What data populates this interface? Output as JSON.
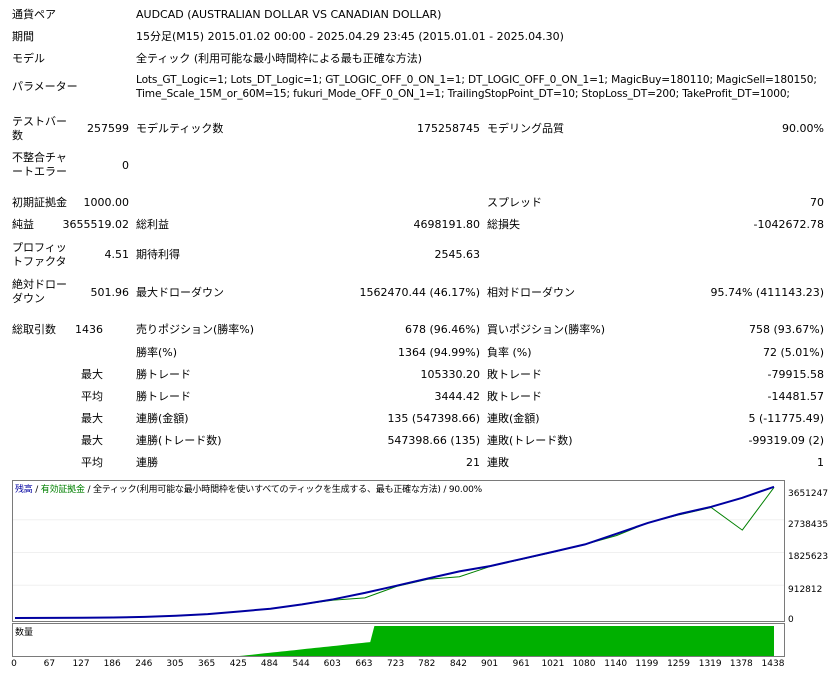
{
  "header": {
    "symbol_label": "通貨ペア",
    "symbol_value": "AUDCAD (AUSTRALIAN DOLLAR VS CANADIAN DOLLAR)",
    "period_label": "期間",
    "period_value": "15分足(M15) 2015.01.02 00:00 - 2025.04.29 23:45 (2015.01.01 - 2025.04.30)",
    "model_label": "モデル",
    "model_value": "全ティック (利用可能な最小時間枠による最も正確な方法)",
    "params_label": "パラメーター",
    "params_line1": "Lots_GT_Logic=1; Lots_DT_Logic=1; GT_LOGIC_OFF_0_ON_1=1; DT_LOGIC_OFF_0_ON_1=1; MagicBuy=180110; MagicSell=180150;",
    "params_line2": "Time_Scale_15M_or_60M=15; fukuri_Mode_OFF_0_ON_1=1; TrailingStopPoint_DT=10; StopLoss_DT=200; TakeProfit_DT=1000;"
  },
  "stats": {
    "bars_label_1": "テストバー",
    "bars_label_2": "数",
    "bars_value": "257599",
    "ticks_label": "モデルティック数",
    "ticks_value": "175258745",
    "quality_label": "モデリング品質",
    "quality_value": "90.00%",
    "mismatch_label_1": "不整合チャ",
    "mismatch_label_2": "ートエラー",
    "mismatch_value": "0",
    "deposit_label": "初期証拠金",
    "deposit_value": "1000.00",
    "spread_label": "スプレッド",
    "spread_value": "70",
    "net_label": "純益",
    "net_value": "3655519.02",
    "gross_profit_label": "総利益",
    "gross_profit_value": "4698191.80",
    "gross_loss_label": "総損失",
    "gross_loss_value": "-1042672.78",
    "pf_label_1": "プロフィッ",
    "pf_label_2": "トファクタ",
    "pf_value": "4.51",
    "expected_label": "期待利得",
    "expected_value": "2545.63",
    "abs_dd_label_1": "絶対ドロー",
    "abs_dd_label_2": "ダウン",
    "abs_dd_value": "501.96",
    "max_dd_label": "最大ドローダウン",
    "max_dd_value": "1562470.44 (46.17%)",
    "rel_dd_label": "相対ドローダウン",
    "rel_dd_value": "95.74% (411143.23)",
    "trades_label": "総取引数",
    "trades_value": "1436",
    "short_label": "売りポジション(勝率%)",
    "short_value": "678 (96.46%)",
    "long_label": "買いポジション(勝率%)",
    "long_value": "758 (93.67%)",
    "win_rate_label": "勝率(%)",
    "win_rate_value": "1364 (94.99%)",
    "loss_rate_label": "負率 (%)",
    "loss_rate_value": "72 (5.01%)",
    "max_1": "最大",
    "largest_win_label": "勝トレード",
    "largest_win_value": "105330.20",
    "largest_loss_label": "敗トレード",
    "largest_loss_value": "-79915.58",
    "avg_1": "平均",
    "avg_win_label": "勝トレード",
    "avg_win_value": "3444.42",
    "avg_loss_label": "敗トレード",
    "avg_loss_value": "-14481.57",
    "max_2": "最大",
    "cons_wins_label": "連勝(金額)",
    "cons_wins_value": "135 (547398.66)",
    "cons_losses_label": "連敗(金額)",
    "cons_losses_value": "5 (-11775.49)",
    "max_3": "最大",
    "cons_profit_label": "連勝(トレード数)",
    "cons_profit_value": "547398.66 (135)",
    "cons_loss_label": "連敗(トレード数)",
    "cons_loss_value": "-99319.09 (2)",
    "avg_2": "平均",
    "avg_cons_wins_label": "連勝",
    "avg_cons_wins_value": "21",
    "avg_cons_losses_label": "連敗",
    "avg_cons_losses_value": "1"
  },
  "chart_legend": {
    "balance": "残高",
    "sep1": " / ",
    "equity": "有効証拠金",
    "sep2": " / ",
    "model": "全ティック(利用可能な最小時間枠を使いすべてのティックを生成する、最も正確な方法)",
    "sep3": " / ",
    "quality": "90.00%",
    "colors": {
      "balance": "#0000a0",
      "equity": "#008000",
      "volume": "#00b000"
    }
  },
  "volume_label": "数量",
  "chart_data": {
    "type": "line",
    "x": [
      0,
      67,
      127,
      186,
      246,
      305,
      365,
      425,
      484,
      544,
      603,
      663,
      723,
      782,
      842,
      901,
      961,
      1021,
      1080,
      1140,
      1199,
      1259,
      1319,
      1378,
      1438
    ],
    "x_tick_labels": [
      "0",
      "67",
      "127",
      "186",
      "246",
      "305",
      "365",
      "425",
      "484",
      "544",
      "603",
      "663",
      "723",
      "782",
      "842",
      "901",
      "961",
      "1021",
      "1080",
      "1140",
      "1199",
      "1259",
      "1319",
      "1378",
      "1438"
    ],
    "y_tick_labels": [
      "3651247",
      "2738435",
      "1825623",
      "912812",
      "0"
    ],
    "ylim": [
      0,
      3651247
    ],
    "xlim": [
      0,
      1438
    ],
    "series": [
      {
        "name": "残高",
        "values": [
          1000,
          3000,
          7000,
          15000,
          30000,
          60000,
          110000,
          180000,
          260000,
          380000,
          520000,
          700000,
          900000,
          1100000,
          1300000,
          1450000,
          1650000,
          1850000,
          2050000,
          2350000,
          2650000,
          2900000,
          3100000,
          3350000,
          3655519
        ]
      },
      {
        "name": "有効証拠金",
        "values": [
          1000,
          3000,
          7000,
          15000,
          30000,
          60000,
          110000,
          180000,
          260000,
          380000,
          500000,
          560000,
          880000,
          1080000,
          1150000,
          1440000,
          1640000,
          1840000,
          2050000,
          2300000,
          2650000,
          2880000,
          3080000,
          2450000,
          3640000
        ]
      }
    ]
  }
}
